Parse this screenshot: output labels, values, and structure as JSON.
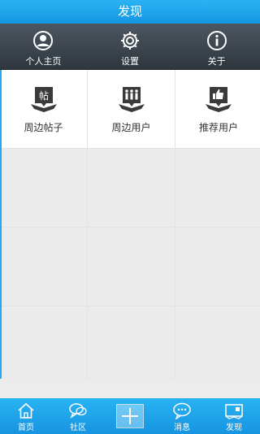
{
  "title": "发现",
  "topbar": {
    "items": [
      {
        "label": "个人主页",
        "icon": "user-circle-icon"
      },
      {
        "label": "设置",
        "icon": "gear-icon"
      },
      {
        "label": "关于",
        "icon": "info-icon"
      }
    ]
  },
  "grid": {
    "items": [
      {
        "label": "周边帖子",
        "icon": "nearby-posts-icon"
      },
      {
        "label": "周边用户",
        "icon": "nearby-users-icon"
      },
      {
        "label": "推荐用户",
        "icon": "recommend-users-icon"
      }
    ]
  },
  "tabbar": {
    "tabs": [
      {
        "label": "首页",
        "icon": "home-icon"
      },
      {
        "label": "社区",
        "icon": "community-icon"
      },
      {
        "label": "",
        "icon": "plus-icon"
      },
      {
        "label": "消息",
        "icon": "message-icon"
      },
      {
        "label": "发现",
        "icon": "discover-icon"
      }
    ]
  },
  "colors": {
    "accent": "#1a9fe8",
    "toolbar_dark": "#3a434c"
  }
}
